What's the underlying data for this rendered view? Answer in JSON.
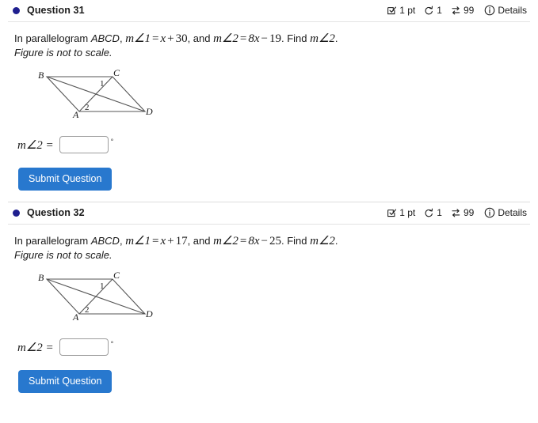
{
  "questions": [
    {
      "bullet": "status-dot",
      "title": "Question 31",
      "meta": {
        "points_icon": "checkbox-check-icon",
        "points": "1 pt",
        "attempts_icon": "undo-arrow-icon",
        "attempts": "1",
        "shuffle_icon": "swap-arrows-icon",
        "shuffle": "99",
        "info_icon": "info-circle-icon",
        "details": "Details"
      },
      "prompt": {
        "lead": "In parallelogram ",
        "shape": "ABCD",
        "comma": ", ",
        "eq1_lhs": "m∠1",
        "eq1_eq": "=",
        "eq1_var": "x",
        "eq1_op": "+",
        "eq1_num": "30",
        "conj": ", and ",
        "eq2_lhs": "m∠2",
        "eq2_eq": "=",
        "eq2_coef": "8x",
        "eq2_op": "−",
        "eq2_num": "19",
        "tail": ". Find ",
        "find": "m∠2",
        "period": ".",
        "note": "Figure is not to scale."
      },
      "figure": {
        "vertices": [
          "B",
          "C",
          "A",
          "D"
        ],
        "angle_labels": [
          "1",
          "2"
        ]
      },
      "answer": {
        "label": "m∠2 =",
        "value": "",
        "placeholder": "",
        "unit": "°"
      },
      "submit_label": "Submit Question"
    },
    {
      "bullet": "status-dot",
      "title": "Question 32",
      "meta": {
        "points_icon": "checkbox-check-icon",
        "points": "1 pt",
        "attempts_icon": "undo-arrow-icon",
        "attempts": "1",
        "shuffle_icon": "swap-arrows-icon",
        "shuffle": "99",
        "info_icon": "info-circle-icon",
        "details": "Details"
      },
      "prompt": {
        "lead": "In parallelogram ",
        "shape": "ABCD",
        "comma": ", ",
        "eq1_lhs": "m∠1",
        "eq1_eq": "=",
        "eq1_var": "x",
        "eq1_op": "+",
        "eq1_num": "17",
        "conj": ", and ",
        "eq2_lhs": "m∠2",
        "eq2_eq": "=",
        "eq2_coef": "8x",
        "eq2_op": "−",
        "eq2_num": "25",
        "tail": ". Find ",
        "find": "m∠2",
        "period": ".",
        "note": "Figure is not to scale."
      },
      "figure": {
        "vertices": [
          "B",
          "C",
          "A",
          "D"
        ],
        "angle_labels": [
          "1",
          "2"
        ]
      },
      "answer": {
        "label": "m∠2 =",
        "value": "",
        "placeholder": "",
        "unit": "°"
      },
      "submit_label": "Submit Question"
    }
  ],
  "colors": {
    "bullet": "#1f1f8f",
    "submit": "#2878ce",
    "divider": "#e3e3e3",
    "figure_line": "#4a4a4a"
  }
}
